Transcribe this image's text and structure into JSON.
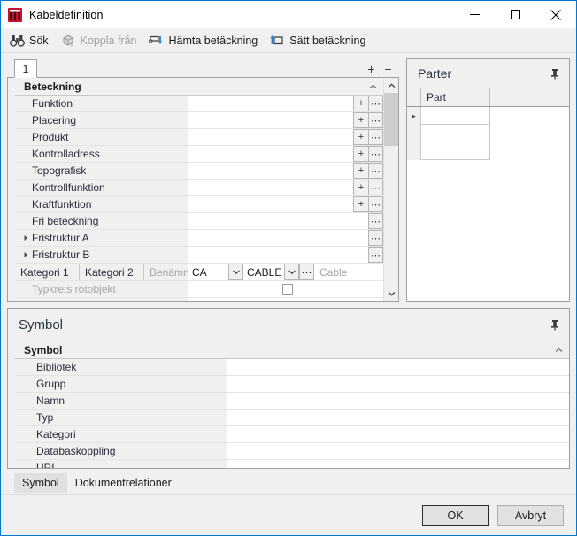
{
  "window": {
    "title": "Kabeldefinition",
    "icon": "app-icon-red-m",
    "minimize_label": "—",
    "maximize_label": "□",
    "close_label": "✕",
    "accent_border": "#0078d7"
  },
  "toolbar": {
    "items": [
      {
        "label": "Sök",
        "icon": "binoculars-icon",
        "disabled": false
      },
      {
        "label": "Koppla från",
        "icon": "unlink-box-icon",
        "disabled": true
      },
      {
        "label": "Hämta betäckning",
        "icon": "fetch-designation-icon",
        "disabled": false
      },
      {
        "label": "Sätt betäckning",
        "icon": "set-designation-icon",
        "disabled": false
      }
    ]
  },
  "designation_panel": {
    "tab_label": "1",
    "add_label": "+",
    "remove_label": "−",
    "category_header": "Beteckning",
    "collapse_icon": "chevron-up-small",
    "rows": [
      {
        "label": "Funktion",
        "value": "",
        "buttons": [
          "+",
          "⋯"
        ],
        "expandable": false,
        "dim": false
      },
      {
        "label": "Placering",
        "value": "",
        "buttons": [
          "+",
          "⋯"
        ],
        "expandable": false,
        "dim": false
      },
      {
        "label": "Produkt",
        "value": "",
        "buttons": [
          "+",
          "⋯"
        ],
        "expandable": false,
        "dim": false
      },
      {
        "label": "Kontrolladress",
        "value": "",
        "buttons": [
          "+",
          "⋯"
        ],
        "expandable": false,
        "dim": false
      },
      {
        "label": "Topografisk",
        "value": "",
        "buttons": [
          "+",
          "⋯"
        ],
        "expandable": false,
        "dim": false
      },
      {
        "label": "Kontrollfunktion",
        "value": "",
        "buttons": [
          "+",
          "⋯"
        ],
        "expandable": false,
        "dim": false
      },
      {
        "label": "Kraftfunktion",
        "value": "",
        "buttons": [
          "+",
          "⋯"
        ],
        "expandable": false,
        "dim": false
      },
      {
        "label": "Fri beteckning",
        "value": "",
        "buttons": [
          "⋯"
        ],
        "expandable": false,
        "dim": false
      },
      {
        "label": "Fristruktur A",
        "value": "",
        "buttons": [
          "⋯"
        ],
        "expandable": true,
        "dim": false
      },
      {
        "label": "Fristruktur B",
        "value": "",
        "buttons": [
          "⋯"
        ],
        "expandable": true,
        "dim": false
      }
    ],
    "kategori_row": {
      "kategori_1_label": "Kategori 1",
      "kategori_2_label": "Kategori 2",
      "benamning_label": "Benämning",
      "kategori_1_value": "CA",
      "kategori_2_value": "CABLE",
      "benamning_value": "Cable",
      "dropdown_icon": "chevron-down-icon",
      "ellipsis_label": "⋯"
    },
    "typkrets_row": {
      "label": "Typkrets rotobjekt",
      "checked": false
    },
    "scroll": {
      "up_icon": "chevron-up-icon",
      "down_icon": "chevron-down-icon"
    }
  },
  "parter_panel": {
    "title": "Parter",
    "pin_icon": "pin-icon",
    "columns": [
      "Part"
    ],
    "rows": [
      {
        "selected": true,
        "cells": [
          ""
        ]
      },
      {
        "selected": false,
        "cells": [
          ""
        ]
      },
      {
        "selected": false,
        "cells": [
          ""
        ]
      }
    ],
    "row_marker": "▸"
  },
  "symbol_panel": {
    "title": "Symbol",
    "pin_icon": "pin-icon",
    "category_header": "Symbol",
    "collapse_icon": "chevron-up-small",
    "rows": [
      {
        "label": "Bibliotek",
        "value": ""
      },
      {
        "label": "Grupp",
        "value": ""
      },
      {
        "label": "Namn",
        "value": ""
      },
      {
        "label": "Typ",
        "value": ""
      },
      {
        "label": "Kategori",
        "value": ""
      },
      {
        "label": "Databaskoppling",
        "value": ""
      },
      {
        "label": "URL",
        "value": ""
      }
    ]
  },
  "bottom_tabs": {
    "items": [
      {
        "label": "Symbol",
        "active": true
      },
      {
        "label": "Dokumentrelationer",
        "active": false
      }
    ]
  },
  "footer": {
    "ok_label": "OK",
    "cancel_label": "Avbryt"
  }
}
